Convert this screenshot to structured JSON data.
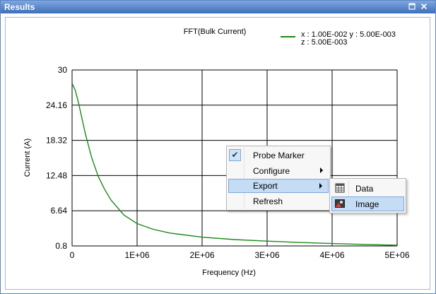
{
  "window": {
    "title": "Results",
    "restore_icon": "restore-icon",
    "close_icon": "close-icon"
  },
  "chart_data": {
    "type": "line",
    "title": "FFT(Bulk Current)",
    "xlabel": "Frequency (Hz)",
    "ylabel": "Current (A)",
    "xlim": [
      0,
      5000000
    ],
    "ylim": [
      0.8,
      30
    ],
    "x_ticks": [
      "0",
      "1E+06",
      "2E+06",
      "3E+06",
      "4E+06",
      "5E+06"
    ],
    "y_ticks": [
      "30",
      "24.16",
      "18.32",
      "12.48",
      "6.64",
      "0.8"
    ],
    "grid": true,
    "legend_placement": "top-right",
    "legend_text": {
      "line1": "x : 1.00E-002   y : 5.00E-003",
      "line2": "z : 5.00E-003"
    },
    "series_color": "#1a8a1a",
    "series": [
      {
        "x": [
          0,
          50000,
          100000,
          200000,
          300000,
          400000,
          500000,
          600000,
          800000,
          1000000,
          1250000,
          1500000,
          2000000,
          2500000,
          3000000,
          3500000,
          4000000,
          4500000,
          5000000
        ],
        "values": [
          27.8,
          26.6,
          24.5,
          19.6,
          15.5,
          12.4,
          10.2,
          8.4,
          5.9,
          4.5,
          3.55,
          2.95,
          2.25,
          1.85,
          1.6,
          1.38,
          1.2,
          1.05,
          0.92
        ]
      }
    ]
  },
  "context_menu": {
    "items": [
      {
        "label": "Probe Marker",
        "checked": true
      },
      {
        "label": "Configure",
        "submenu": true
      },
      {
        "label": "Export",
        "submenu": true,
        "highlighted": true
      },
      {
        "label": "Refresh"
      }
    ]
  },
  "export_submenu": {
    "items": [
      {
        "label": "Data",
        "icon": "data-icon"
      },
      {
        "label": "Image",
        "icon": "image-icon",
        "highlighted": true
      }
    ]
  }
}
